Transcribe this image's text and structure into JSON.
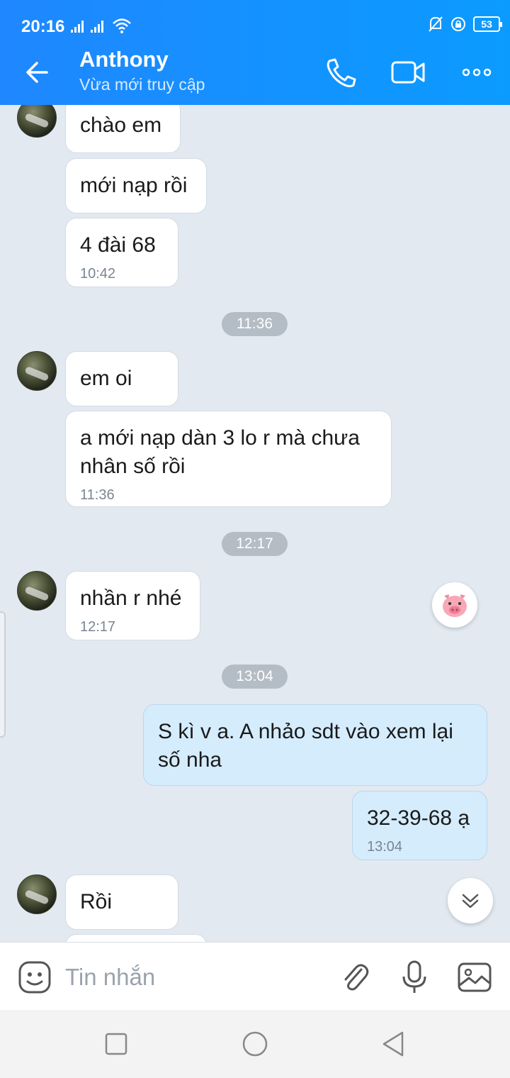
{
  "status": {
    "time": "20:16",
    "battery": "53"
  },
  "header": {
    "name": "Anthony",
    "status": "Vừa mới truy cập"
  },
  "messages": [
    {
      "text": "chào em"
    },
    {
      "text": "mới nạp rồi"
    },
    {
      "text": "4 đài 68",
      "time": "10:42"
    },
    {
      "divider": "11:36"
    },
    {
      "text": "em oi"
    },
    {
      "text": "a mới nạp dàn 3 lo r mà chưa nhân số rồi",
      "time": "11:36"
    },
    {
      "divider": "12:17"
    },
    {
      "text": "nhần r nhé",
      "time": "12:17"
    },
    {
      "divider": "13:04"
    },
    {
      "text": "S kì v a. A nhảo sdt vào xem lại số nha"
    },
    {
      "text": "32-39-68 ạ",
      "time": "13:04"
    },
    {
      "text": "Rồi"
    }
  ],
  "composer": {
    "placeholder": "Tin nhắn"
  },
  "colors": {
    "header": "#1f87ff",
    "chat_bg": "#e2e9f1",
    "my_bubble": "#d5ecfd"
  },
  "icons": [
    "back-arrow-icon",
    "phone-icon",
    "video-icon",
    "more-icon",
    "pig-emoji-icon",
    "scroll-down-icon",
    "emoji-icon",
    "attach-icon",
    "mic-icon",
    "image-icon"
  ]
}
